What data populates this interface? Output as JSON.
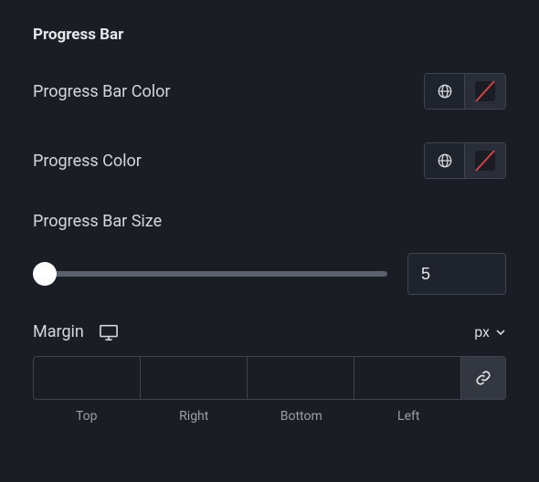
{
  "section": {
    "title": "Progress Bar"
  },
  "progress_bar_color": {
    "label": "Progress Bar Color",
    "globe_icon": "globe-icon",
    "swatch": "none"
  },
  "progress_color": {
    "label": "Progress Color",
    "globe_icon": "globe-icon",
    "swatch": "none"
  },
  "progress_bar_size": {
    "label": "Progress Bar Size",
    "value": "5"
  },
  "margin": {
    "label": "Margin",
    "device_icon": "desktop-icon",
    "unit": "px",
    "sides": {
      "top": {
        "label": "Top",
        "value": ""
      },
      "right": {
        "label": "Right",
        "value": ""
      },
      "bottom": {
        "label": "Bottom",
        "value": ""
      },
      "left": {
        "label": "Left",
        "value": ""
      }
    },
    "link_icon": "link-icon"
  }
}
